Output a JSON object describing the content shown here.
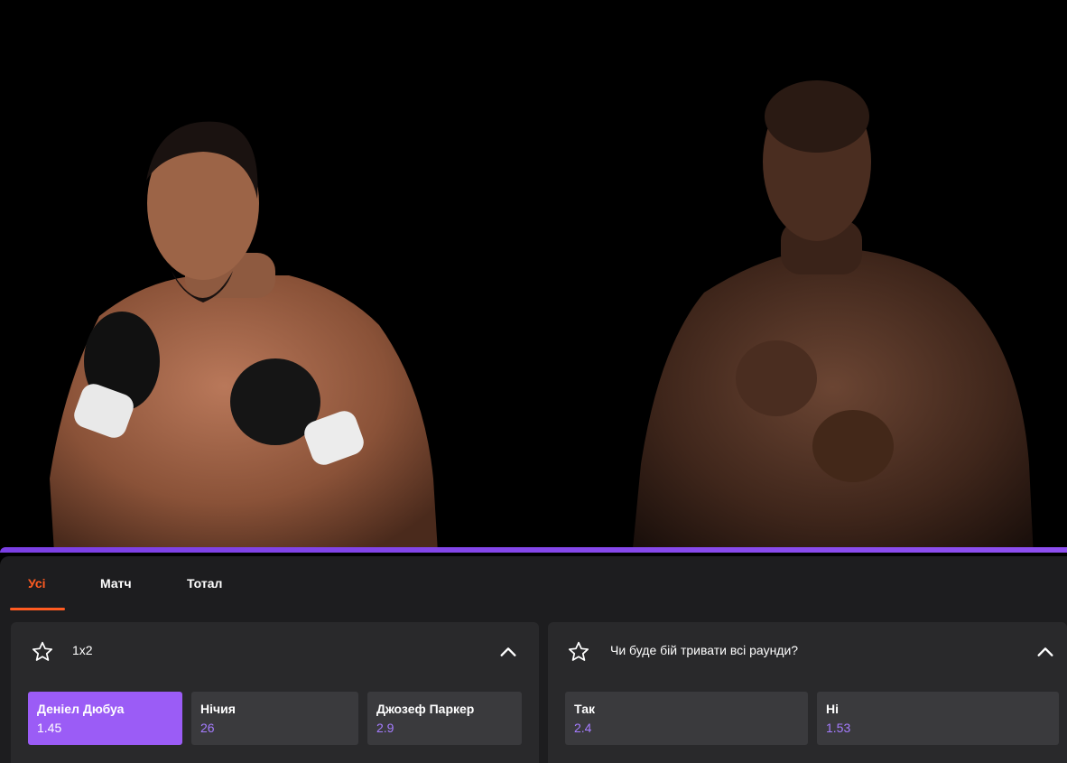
{
  "hero": {
    "fighter_left_image": "boxer-joseph-parker",
    "fighter_right_image": "boxer-daniel-dubois"
  },
  "tabs": [
    {
      "label": "Усі",
      "active": true
    },
    {
      "label": "Матч",
      "active": false
    },
    {
      "label": "Тотал",
      "active": false
    }
  ],
  "markets": [
    {
      "title": "1x2",
      "icon": "star-icon",
      "collapse_icon": "chevron-up-icon",
      "odds": [
        {
          "name": "Деніел Дюбуа",
          "value": "1.45",
          "selected": true
        },
        {
          "name": "Нічия",
          "value": "26",
          "selected": false
        },
        {
          "name": "Джозеф Паркер",
          "value": "2.9",
          "selected": false
        }
      ]
    },
    {
      "title": "Чи буде бій тривати всі раунди?",
      "icon": "star-icon",
      "collapse_icon": "chevron-up-icon",
      "odds": [
        {
          "name": "Так",
          "value": "2.4",
          "selected": false
        },
        {
          "name": "Ні",
          "value": "1.53",
          "selected": false
        }
      ]
    }
  ],
  "colors": {
    "accent_orange": "#ff5b21",
    "accent_purple": "#9b5cf6",
    "panel_bg": "#1d1d1f",
    "card_bg": "#29292b",
    "odd_bg": "#3a3a3d"
  }
}
